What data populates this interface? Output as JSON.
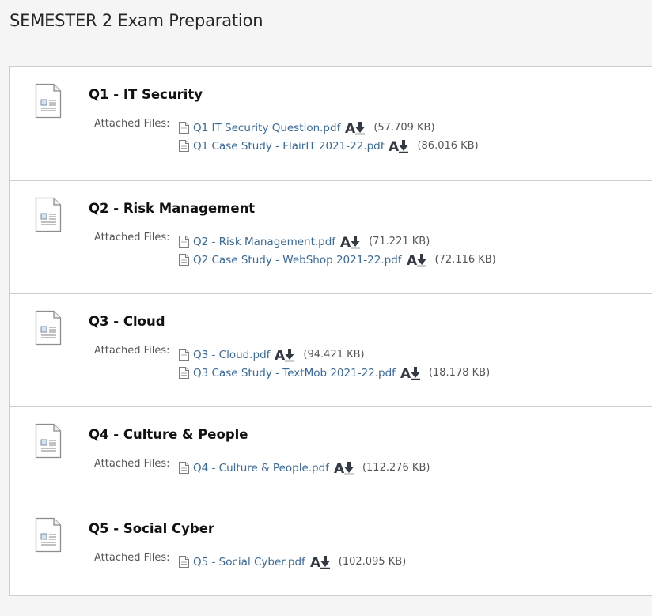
{
  "page": {
    "title": "SEMESTER 2 Exam Preparation"
  },
  "attached_files_label": "Attached Files:",
  "icons": {
    "item": "document-icon",
    "file": "file-icon",
    "download": "read-aloud-download-icon"
  },
  "colors": {
    "link": "#3a6a96",
    "border": "#cdcdcd",
    "page_background": "#f5f5f5"
  },
  "items": [
    {
      "title": "Q1 - IT Security",
      "files": [
        {
          "name": "Q1 IT Security Question.pdf",
          "size": "(57.709 KB)"
        },
        {
          "name": "Q1 Case Study - FlairIT 2021-22.pdf",
          "size": "(86.016 KB)"
        }
      ]
    },
    {
      "title": "Q2 - Risk Management",
      "files": [
        {
          "name": "Q2 - Risk Management.pdf",
          "size": "(71.221 KB)"
        },
        {
          "name": "Q2 Case Study - WebShop 2021-22.pdf",
          "size": "(72.116 KB)"
        }
      ]
    },
    {
      "title": "Q3 - Cloud",
      "files": [
        {
          "name": "Q3 - Cloud.pdf",
          "size": "(94.421 KB)"
        },
        {
          "name": "Q3 Case Study - TextMob 2021-22.pdf",
          "size": "(18.178 KB)"
        }
      ]
    },
    {
      "title": "Q4 - Culture & People",
      "files": [
        {
          "name": "Q4 - Culture & People.pdf",
          "size": "(112.276 KB)"
        }
      ]
    },
    {
      "title": "Q5 - Social Cyber",
      "files": [
        {
          "name": "Q5 - Social Cyber.pdf",
          "size": "(102.095 KB)"
        }
      ]
    }
  ]
}
